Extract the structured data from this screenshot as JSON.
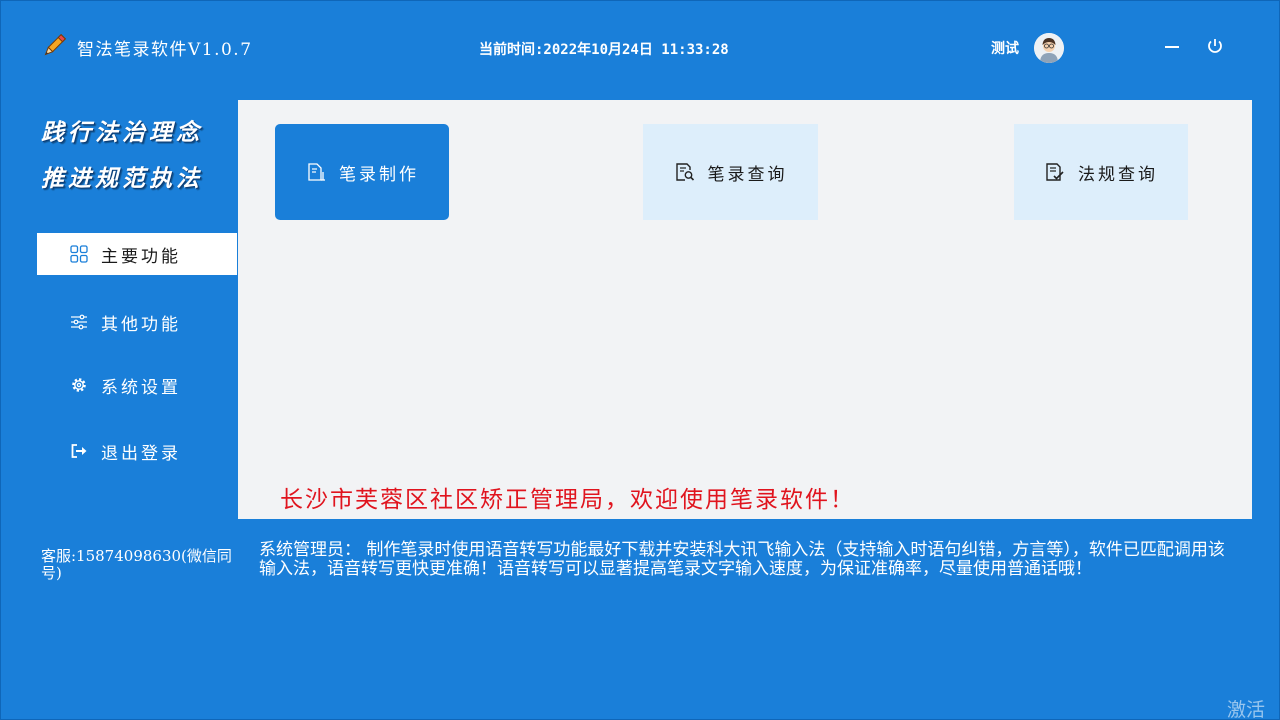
{
  "header": {
    "app_title": "智法笔录软件V1.0.7",
    "clock_label": "当前时间:2022年10月24日 11:33:28",
    "user_name": "测试",
    "avatar_icon": "user-avatar-icon",
    "minimize_icon": "minimize-icon",
    "power_icon": "power-icon"
  },
  "sidebar": {
    "slogan_line1": "践行法治理念",
    "slogan_line2": "推进规范执法",
    "items": [
      {
        "label": "主要功能",
        "icon": "grid-icon",
        "active": true
      },
      {
        "label": "其他功能",
        "icon": "sliders-icon",
        "active": false
      },
      {
        "label": "系统设置",
        "icon": "gear-icon",
        "active": false
      },
      {
        "label": "退出登录",
        "icon": "logout-icon",
        "active": false
      }
    ],
    "support": "客服:15874098630(微信同号)"
  },
  "main": {
    "cards": [
      {
        "label": "笔录制作",
        "icon": "document-edit-icon"
      },
      {
        "label": "笔录查询",
        "icon": "document-search-icon"
      },
      {
        "label": "法规查询",
        "icon": "document-check-icon"
      }
    ],
    "welcome": "长沙市芙蓉区社区矫正管理局，欢迎使用笔录软件！"
  },
  "notice": "系统管理员： 制作笔录时使用语音转写功能最好下载并安装科大讯飞输入法（支持输入时语句纠错，方言等），软件已匹配调用该输入法，语音转写更快更准确！语音转写可以显著提高笔录文字输入速度，为保证准确率，尽量使用普通话哦！",
  "watermark": "激活",
  "colors": {
    "primary": "#1a7fd9",
    "panel": "#f2f3f5",
    "card_light": "#ddeefb",
    "welcome_red": "#e0141e"
  }
}
